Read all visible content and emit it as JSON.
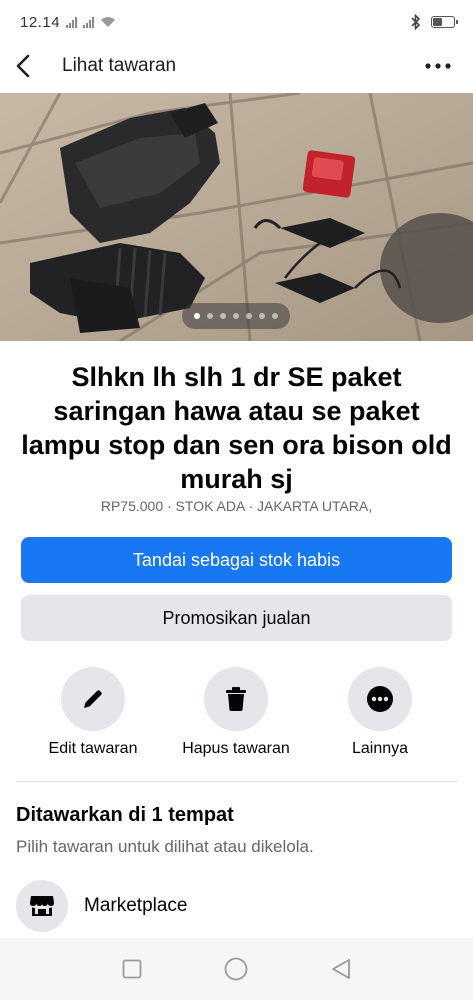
{
  "status_bar": {
    "time": "12.14"
  },
  "header": {
    "title": "Lihat tawaran"
  },
  "photo": {
    "image_count": 7,
    "active_index": 1
  },
  "listing": {
    "title": "Slhkn lh slh 1 dr SE paket saringan hawa atau se paket lampu stop dan sen ora bison old murah sj",
    "meta": "RP75.000 · STOK ADA · JAKARTA UTARA,"
  },
  "buttons": {
    "mark_sold": "Tandai sebagai stok habis",
    "promote": "Promosikan jualan"
  },
  "actions": [
    {
      "label": "Edit tawaran",
      "icon": "pencil-icon"
    },
    {
      "label": "Hapus tawaran",
      "icon": "trash-icon"
    },
    {
      "label": "Lainnya",
      "icon": "more-icon"
    }
  ],
  "offered": {
    "title": "Ditawarkan di 1 tempat",
    "subtitle": "Pilih tawaran untuk dilihat atau dikelola.",
    "places": [
      {
        "label": "Marketplace",
        "icon": "marketplace-shop-icon"
      }
    ]
  },
  "colors": {
    "accent": "#1877f2",
    "secondary_bg": "#e4e6eb",
    "muted_text": "#65676b"
  }
}
